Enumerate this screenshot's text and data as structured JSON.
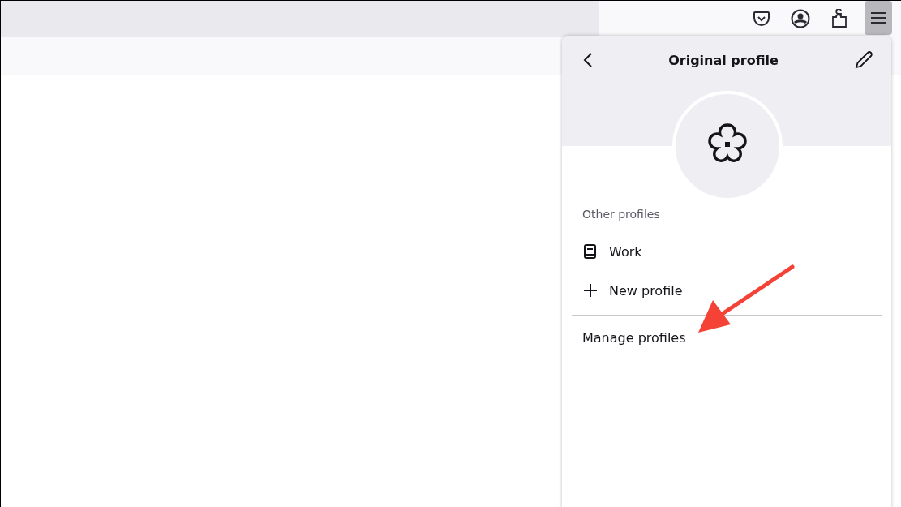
{
  "panel": {
    "title": "Original profile",
    "section_label": "Other profiles",
    "items": [
      {
        "kind": "profile",
        "label": "Work"
      },
      {
        "kind": "new",
        "label": "New profile"
      }
    ],
    "footer_link": "Manage profiles"
  }
}
